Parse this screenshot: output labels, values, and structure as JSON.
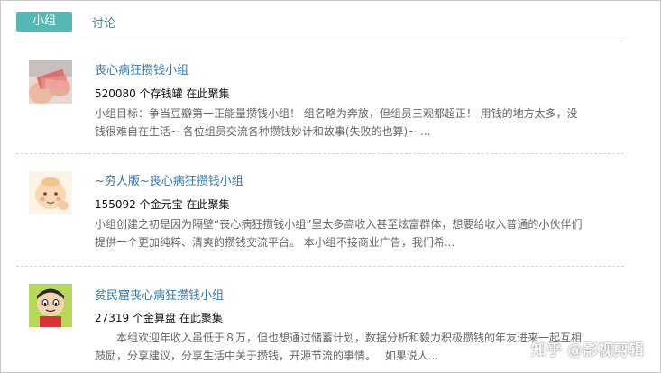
{
  "tabs": {
    "active_label": "小组",
    "other_label": "讨论"
  },
  "groups": [
    {
      "title": "丧心病狂攒钱小组",
      "count": "520080",
      "member_name": "个存钱罐",
      "status": "在此聚集",
      "desc_line1": "小组目标：争当豆瓣第一正能量攒钱小组！ 组名略为奔放，但组员三观都超正！ 用钱的地方太多，没",
      "desc_line2": "钱很难自在生活~ 各位组员交流各种攒钱妙计和故事(失败的也算)~ ..."
    },
    {
      "title": "~穷人版~丧心病狂攒钱小组",
      "count": "155092",
      "member_name": "个金元宝",
      "status": "在此聚集",
      "desc_line1": "小组创建之初是因为隔壁“丧心病狂攒钱小组”里太多高收入甚至炫富群体，想要给收入普通的小伙伴们",
      "desc_line2": "提供一个更加纯粹、清爽的攒钱交流平台。 本小组不接商业广告，我们希..."
    },
    {
      "title": "贫民窟丧心病狂攒钱小组",
      "count": "27319",
      "member_name": "个金算盘",
      "status": "在此聚集",
      "desc_line1": "　　本组欢迎年收入虽低于８万，但也想通过储蓄计划，数据分析和毅力积极攒钱的年友进来一起互相",
      "desc_line2": "鼓励，分享建议，分享生活中关于攒钱，开源节流的事情。　 如果说人..."
    }
  ],
  "watermark": "知乎 @影视剪辑"
}
